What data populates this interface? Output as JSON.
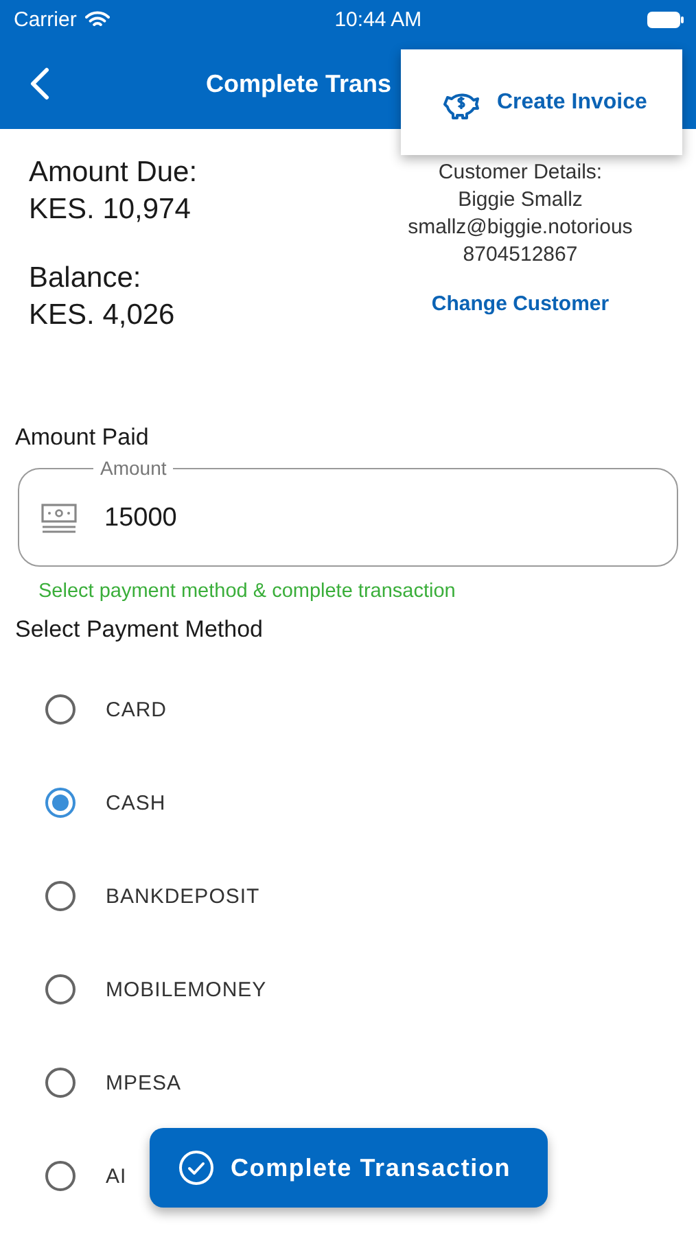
{
  "status_bar": {
    "carrier": "Carrier",
    "time": "10:44 AM"
  },
  "nav_bar": {
    "title": "Complete Trans"
  },
  "menu": {
    "items": [
      {
        "label": "Create Invoice"
      }
    ]
  },
  "summary": [
    {
      "label": "Amount Due:",
      "value": "KES. 10,974"
    },
    {
      "label": "Balance:",
      "value": "KES. 4,026"
    }
  ],
  "customer": {
    "heading": "Customer Details:",
    "lines": [
      "Biggie Smallz",
      "smallz@biggie.notorious",
      "8704512867"
    ],
    "link": "Change Customer"
  },
  "amount_paid": {
    "label": "Amount Paid",
    "field_label": "Amount",
    "value": "15000",
    "hint": "Select payment method & complete transaction"
  },
  "payment_method": {
    "label": "Select Payment Method",
    "options": [
      {
        "label": "CARD",
        "selected": false
      },
      {
        "label": "CASH",
        "selected": true
      },
      {
        "label": "BANKDEPOSIT",
        "selected": false
      },
      {
        "label": "MOBILEMONEY",
        "selected": false
      },
      {
        "label": "MPESA",
        "selected": false
      },
      {
        "label": "AI",
        "selected": false
      }
    ]
  },
  "complete_button": {
    "label": "Complete Transaction"
  }
}
